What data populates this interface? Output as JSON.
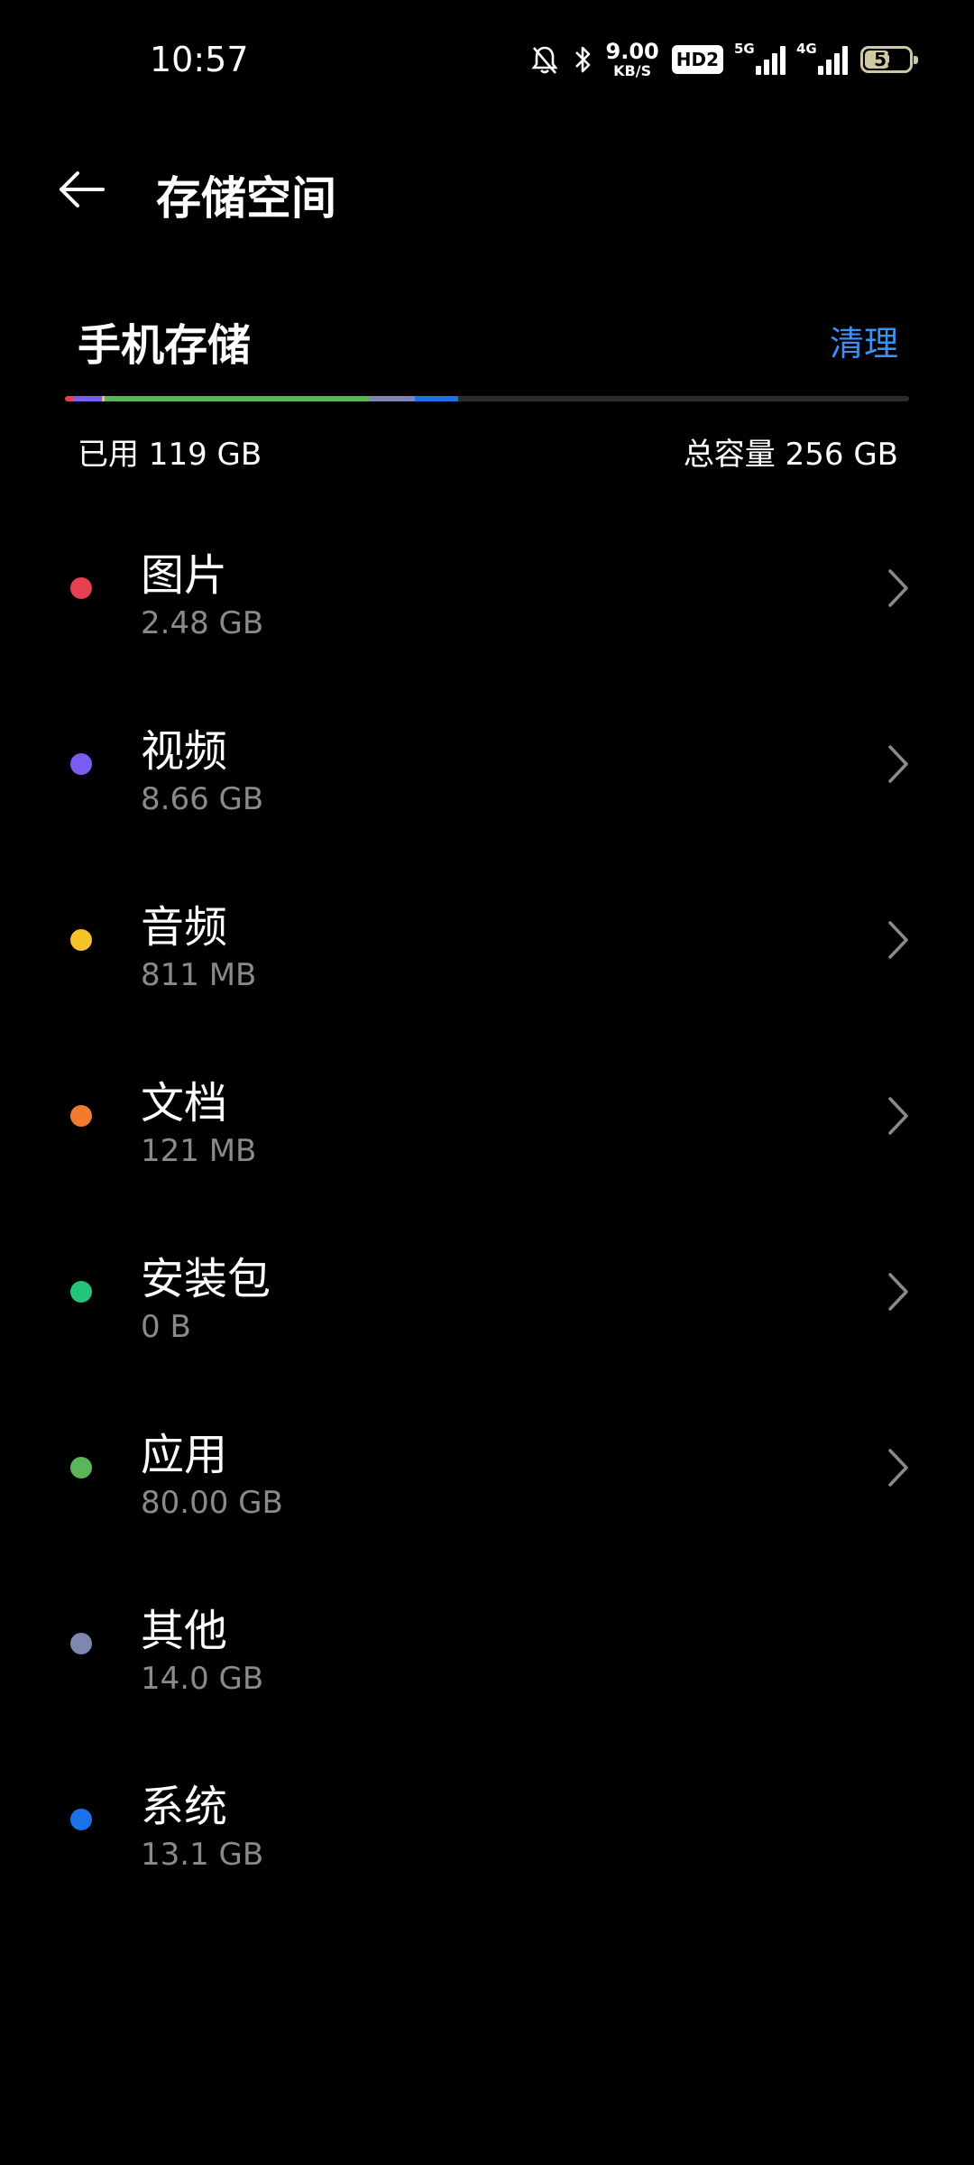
{
  "status_bar": {
    "time": "10:57",
    "net_speed_value": "9.00",
    "net_speed_unit": "KB/S",
    "hd_badge": "HD2",
    "signal_1_label": "5G",
    "signal_2_label": "4G",
    "battery_level": "52",
    "icons": [
      "bell-muted-icon",
      "bluetooth-icon",
      "signal-5g-icon",
      "signal-4g-icon",
      "battery-icon"
    ]
  },
  "header": {
    "title": "存储空间",
    "back_icon": "arrow-left-icon"
  },
  "storage": {
    "section_title": "手机存储",
    "clean_label": "清理",
    "used_label": "已用 119 GB",
    "total_label": "总容量 256 GB",
    "colors": {
      "accent": "#3f8ef5",
      "track": "#2c2c2c"
    }
  },
  "categories": [
    {
      "name": "图片",
      "size": "2.48 GB",
      "color": "#e8404f",
      "has_chevron": true
    },
    {
      "name": "视频",
      "size": "8.66 GB",
      "color": "#7b5cf0",
      "has_chevron": true
    },
    {
      "name": "音频",
      "size": "811 MB",
      "color": "#f5c228",
      "has_chevron": true
    },
    {
      "name": "文档",
      "size": "121 MB",
      "color": "#f27b2e",
      "has_chevron": true
    },
    {
      "name": "安装包",
      "size": "0 B",
      "color": "#22c47c",
      "has_chevron": true
    },
    {
      "name": "应用",
      "size": "80.00  GB",
      "color": "#5db55a",
      "has_chevron": true
    },
    {
      "name": "其他",
      "size": "14.0 GB",
      "color": "#7d87b0",
      "has_chevron": false
    },
    {
      "name": "系统",
      "size": "13.1 GB",
      "color": "#1a73e8",
      "has_chevron": false
    }
  ],
  "usage_bar_segments": [
    {
      "color": "#e8404f",
      "gb": 2.48
    },
    {
      "color": "#7b5cf0",
      "gb": 8.66
    },
    {
      "color": "#f5c228",
      "gb": 0.811
    },
    {
      "color": "#f27b2e",
      "gb": 0.121
    },
    {
      "color": "#22c47c",
      "gb": 0
    },
    {
      "color": "#5db55a",
      "gb": 80.0
    },
    {
      "color": "#7d87b0",
      "gb": 14.0
    },
    {
      "color": "#1a73e8",
      "gb": 13.1
    }
  ],
  "total_capacity_gb": 256
}
